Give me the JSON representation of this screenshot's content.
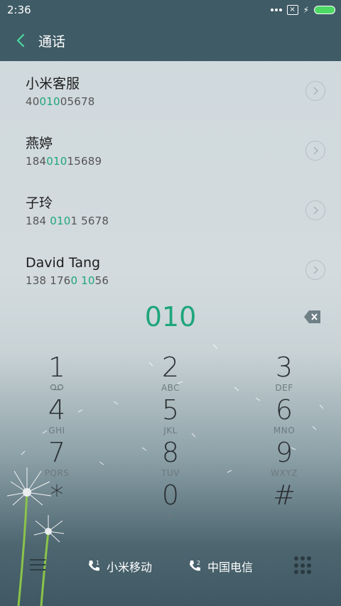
{
  "status": {
    "time": "2:36"
  },
  "header": {
    "title": "通话"
  },
  "contacts": [
    {
      "name": "小米客服",
      "num_pre": "40",
      "num_hl": "010",
      "num_post": "05678"
    },
    {
      "name": "燕婷",
      "num_pre": "184",
      "num_hl": "010",
      "num_post": "15689"
    },
    {
      "name": "子玲",
      "num_pre": "184 ",
      "num_hl": "010",
      "num_post": "1 5678"
    },
    {
      "name": "David Tang",
      "num_pre": "138 176",
      "num_hl": "0 10",
      "num_post": "56"
    }
  ],
  "input": {
    "number": "010"
  },
  "keypad": [
    {
      "digit": "1",
      "letters": ""
    },
    {
      "digit": "2",
      "letters": "ABC"
    },
    {
      "digit": "3",
      "letters": "DEF"
    },
    {
      "digit": "4",
      "letters": "GHI"
    },
    {
      "digit": "5",
      "letters": "JKL"
    },
    {
      "digit": "6",
      "letters": "MNO"
    },
    {
      "digit": "7",
      "letters": "PQRS"
    },
    {
      "digit": "8",
      "letters": "TUV"
    },
    {
      "digit": "9",
      "letters": "WXYZ"
    },
    {
      "digit": "*",
      "letters": ""
    },
    {
      "digit": "0",
      "letters": "+"
    },
    {
      "digit": "#",
      "letters": ""
    }
  ],
  "bottom": {
    "sim1_label": "小米移动",
    "sim2_label": "中国电信",
    "sim1_index": "1",
    "sim2_index": "2"
  },
  "colors": {
    "accent": "#1ea67a",
    "header": "#3f5b66"
  }
}
